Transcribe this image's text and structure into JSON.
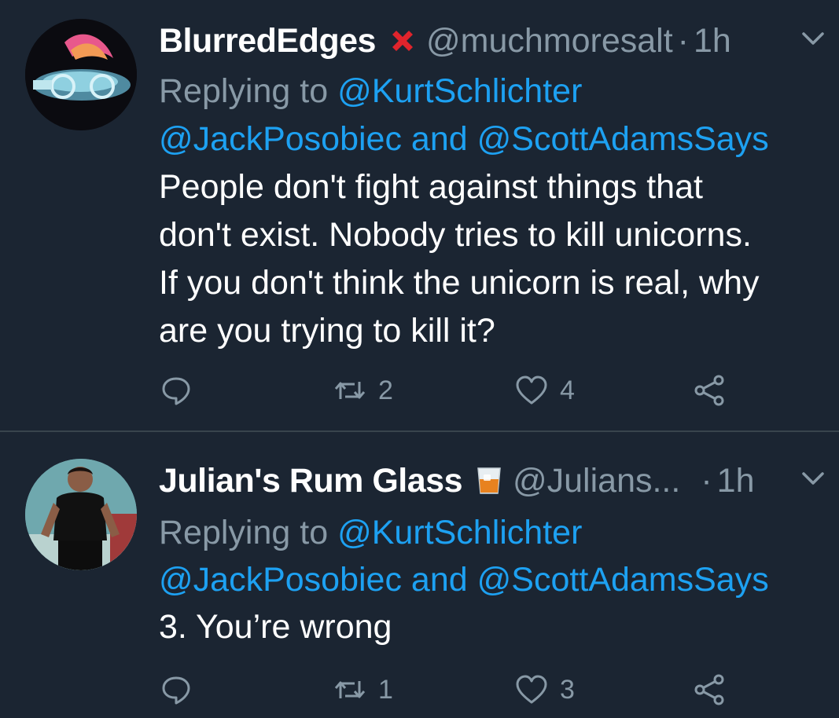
{
  "tweets": [
    {
      "display_name": "BlurredEdges",
      "badge": "red-x-emoji",
      "handle": "@muchmoresalt",
      "separator": "·",
      "time": "1h",
      "replying_prefix": "Replying to",
      "reply_to_1": "@KurtSchlichter",
      "reply_to_2": "@JackPosobiec",
      "reply_and": "and",
      "reply_to_3": "@ScottAdamsSays",
      "body_lines": [
        "People don't fight against things that",
        "don't exist.  Nobody tries to kill unicorns.",
        "If you don't think the unicorn is real, why",
        "are you trying to kill it?"
      ],
      "retweets": "2",
      "likes": "4"
    },
    {
      "display_name": "Julian's Rum Glass",
      "badge": "tumbler-glass-emoji",
      "handle": "@Julians...",
      "separator": "·",
      "time": "1h",
      "replying_prefix": "Replying to",
      "reply_to_1": "@KurtSchlichter",
      "reply_to_2": "@JackPosobiec",
      "reply_and": "and",
      "reply_to_3": "@ScottAdamsSays",
      "body_lines": [
        "3. You’re wrong"
      ],
      "retweets": "1",
      "likes": "3"
    }
  ],
  "colors": {
    "background": "#1b2532",
    "text": "#ffffff",
    "muted": "#8899a6",
    "link": "#1da1f2",
    "divider": "#38444d"
  }
}
